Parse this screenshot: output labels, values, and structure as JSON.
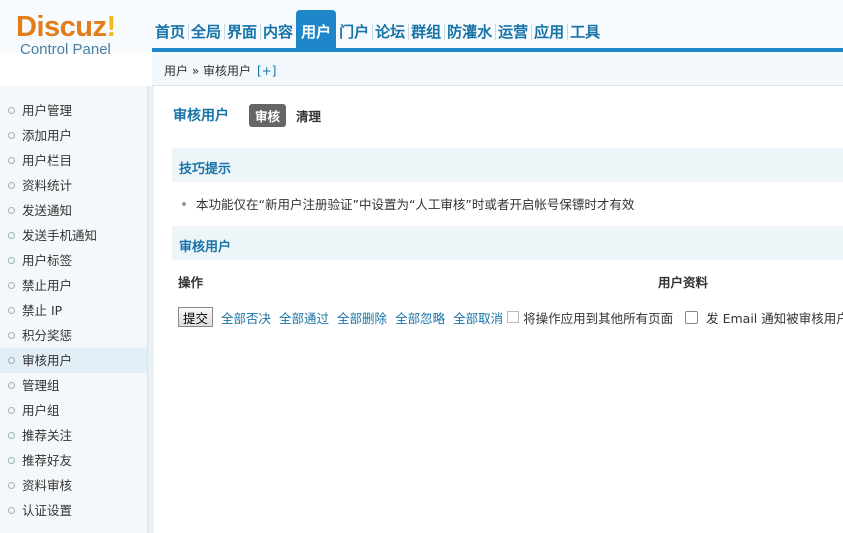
{
  "logo": {
    "brand_main": "Discuz",
    "brand_bang": "!",
    "subtitle": "Control Panel"
  },
  "nav": {
    "items": [
      {
        "label": "首页",
        "active": false
      },
      {
        "label": "全局",
        "active": false
      },
      {
        "label": "界面",
        "active": false
      },
      {
        "label": "内容",
        "active": false
      },
      {
        "label": "用户",
        "active": true
      },
      {
        "label": "门户",
        "active": false
      },
      {
        "label": "论坛",
        "active": false
      },
      {
        "label": "群组",
        "active": false
      },
      {
        "label": "防灌水",
        "active": false
      },
      {
        "label": "运营",
        "active": false
      },
      {
        "label": "应用",
        "active": false
      },
      {
        "label": "工具",
        "active": false
      }
    ],
    "accent_color": "#1e87c9"
  },
  "breadcrumb": {
    "path": "用户 » 审核用户",
    "add": "[+]"
  },
  "sidebar": {
    "items": [
      {
        "label": "用户管理"
      },
      {
        "label": "添加用户"
      },
      {
        "label": "用户栏目"
      },
      {
        "label": "资料统计"
      },
      {
        "label": "发送通知"
      },
      {
        "label": "发送手机通知"
      },
      {
        "label": "用户标签"
      },
      {
        "label": "禁止用户"
      },
      {
        "label": "禁止 IP"
      },
      {
        "label": "积分奖惩"
      },
      {
        "label": "审核用户",
        "active": true
      },
      {
        "label": "管理组"
      },
      {
        "label": "用户组"
      },
      {
        "label": "推荐关注"
      },
      {
        "label": "推荐好友"
      },
      {
        "label": "资料审核"
      },
      {
        "label": "认证设置"
      }
    ]
  },
  "main": {
    "title": "审核用户",
    "tabs": {
      "audit": "审核",
      "clean": "清理"
    },
    "tips": {
      "heading": "技巧提示",
      "text": "本功能仅在“新用户注册验证”中设置为“人工审核”时或者开启帐号保镖时才有效"
    },
    "audit_section": {
      "heading": "审核用户",
      "col_operation": "操作",
      "col_profile": "用户资料"
    },
    "actions": {
      "submit": "提交",
      "links": [
        "全部否决",
        "全部通过",
        "全部删除",
        "全部忽略",
        "全部取消"
      ],
      "apply_all_label": "将操作应用到其他所有页面",
      "email_notify_label": "发 Email 通知被审核用户"
    }
  }
}
